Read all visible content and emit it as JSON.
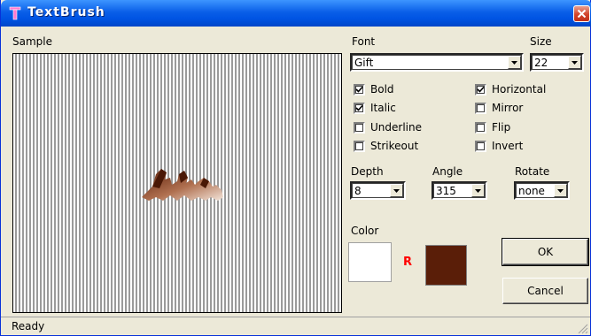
{
  "window": {
    "title": "TextBrush",
    "app_icon": "T-letter-icon",
    "close_icon": "close-icon"
  },
  "sample": {
    "label": "Sample",
    "preview_text": "Abc"
  },
  "font": {
    "label": "Font",
    "value": "Gift"
  },
  "size": {
    "label": "Size",
    "value": "22"
  },
  "options": {
    "bold": {
      "label": "Bold",
      "checked": true
    },
    "italic": {
      "label": "Italic",
      "checked": true
    },
    "underline": {
      "label": "Underline",
      "checked": false
    },
    "strikeout": {
      "label": "Strikeout",
      "checked": false
    },
    "horizontal": {
      "label": "Horizontal",
      "checked": true
    },
    "mirror": {
      "label": "Mirror",
      "checked": false
    },
    "flip": {
      "label": "Flip",
      "checked": false
    },
    "invert": {
      "label": "Invert",
      "checked": false
    }
  },
  "depth": {
    "label": "Depth",
    "value": "8"
  },
  "angle": {
    "label": "Angle",
    "value": "315"
  },
  "rotate": {
    "label": "Rotate",
    "value": "none"
  },
  "color": {
    "label": "Color",
    "background_swatch": "#ffffff",
    "channel_marker": "R",
    "channel_marker_color": "#ff0000",
    "selected_swatch": "#5a1e08"
  },
  "buttons": {
    "ok": "OK",
    "cancel": "Cancel"
  },
  "status": {
    "text": "Ready"
  },
  "colors": {
    "titlebar": "#0054e3",
    "dialog_face": "#ece9d8"
  }
}
